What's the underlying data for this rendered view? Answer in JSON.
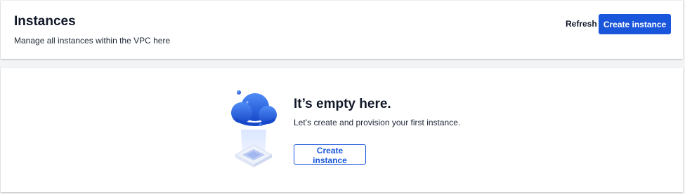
{
  "header": {
    "title": "Instances",
    "subtitle": "Manage all instances within the VPC here",
    "refresh_label": "Refresh",
    "create_label": "Create instance"
  },
  "empty_state": {
    "icon": "cloud-illustration",
    "title": "It’s empty here.",
    "description": "Let’s create and provision your first instance.",
    "button_label": "Create instance"
  },
  "colors": {
    "primary": "#1a56db",
    "background": "#f3f4f6",
    "card": "#ffffff",
    "text": "#111827"
  }
}
